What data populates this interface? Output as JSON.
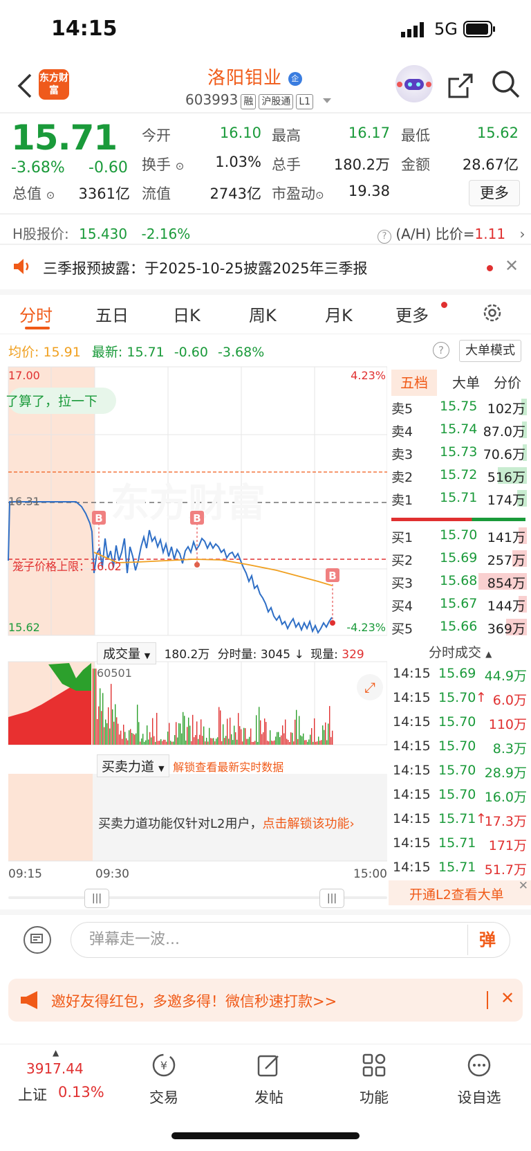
{
  "status": {
    "time": "14:15",
    "network": "5G"
  },
  "header": {
    "app_logo": "东方财富",
    "stock_name": "洛阳钼业",
    "stock_badge": "企",
    "stock_code": "603993",
    "tags": [
      "融",
      "沪股通",
      "L1"
    ]
  },
  "quote": {
    "price": "15.71",
    "change_pct": "-3.68%",
    "change_abs": "-0.60",
    "fields": [
      {
        "label": "今开",
        "value": "16.10",
        "color": "green"
      },
      {
        "label": "最高",
        "value": "16.17",
        "color": "green"
      },
      {
        "label": "最低",
        "value": "15.62",
        "color": "green"
      },
      {
        "label": "换手",
        "value": "1.03%",
        "color": "black"
      },
      {
        "label": "总手",
        "value": "180.2万",
        "color": "black"
      },
      {
        "label": "金额",
        "value": "28.67亿",
        "color": "black"
      },
      {
        "label": "总值",
        "value": "3361亿",
        "color": "black"
      },
      {
        "label": "流值",
        "value": "2743亿",
        "color": "black"
      },
      {
        "label": "市盈动",
        "value": "19.38",
        "color": "black"
      }
    ],
    "more_label": "更多"
  },
  "hshare": {
    "label": "H股报价:",
    "price": "15.430",
    "pct": "-2.16%",
    "ah_label": "(A/H) 比价=",
    "ah_value": "1.11"
  },
  "notice": {
    "text": "三季报预披露：于2025-10-25披露2025年三季报"
  },
  "tabs": [
    "分时",
    "五日",
    "日K",
    "周K",
    "月K",
    "更多"
  ],
  "chart_header": {
    "avg_label": "均价:",
    "avg_value": "15.91",
    "latest_label": "最新:",
    "latest_value": "15.71",
    "latest_change": "-0.60",
    "latest_pct": "-3.68%",
    "big_mode": "大单模式"
  },
  "chart_labels": {
    "top_price": "17.00",
    "top_pct": "4.23%",
    "prev_close": "16.31",
    "bottom_price": "15.62",
    "bottom_pct": "-4.23%",
    "danmu_bubble": "了算了，拉一下",
    "cage_limit": "笼子价格上限：16.02",
    "watermark": "东方财富",
    "buy_marker": "B"
  },
  "volume_bar": {
    "label": "成交量",
    "total": "180.2万",
    "split_label": "分时量:",
    "split_value": "3045",
    "arrow": "↓",
    "now_label": "现量:",
    "now_value": "329",
    "max_vol": "60501"
  },
  "force": {
    "label": "买卖力道",
    "unlock": "解锁查看最新实时数据",
    "notice": "买卖力道功能仅针对L2用户，",
    "notice_link": "点击解锁该功能"
  },
  "time_axis": [
    "09:15",
    "09:30",
    "15:00"
  ],
  "orderbook": {
    "tabs": [
      "五档",
      "大单",
      "分价"
    ],
    "sells": [
      {
        "label": "卖5",
        "price": "15.75",
        "vol": "102万",
        "bar": 0.12
      },
      {
        "label": "卖4",
        "price": "15.74",
        "vol": "87.0万",
        "bar": 0.1
      },
      {
        "label": "卖3",
        "price": "15.73",
        "vol": "70.6万",
        "bar": 0.08
      },
      {
        "label": "卖2",
        "price": "15.72",
        "vol": "516万",
        "bar": 0.6
      },
      {
        "label": "卖1",
        "price": "15.71",
        "vol": "174万",
        "bar": 0.2
      }
    ],
    "buys": [
      {
        "label": "买1",
        "price": "15.70",
        "vol": "141万",
        "bar": 0.17
      },
      {
        "label": "买2",
        "price": "15.69",
        "vol": "257万",
        "bar": 0.3
      },
      {
        "label": "买3",
        "price": "15.68",
        "vol": "854万",
        "bar": 1.0
      },
      {
        "label": "买4",
        "price": "15.67",
        "vol": "144万",
        "bar": 0.17
      },
      {
        "label": "买5",
        "price": "15.66",
        "vol": "369万",
        "bar": 0.43
      }
    ]
  },
  "trades": {
    "title": "分时成交",
    "rows": [
      {
        "time": "14:15",
        "price": "15.69",
        "vol": "44.9万",
        "color": "green",
        "arrow": ""
      },
      {
        "time": "14:15",
        "price": "15.70",
        "vol": "6.0万",
        "color": "red",
        "arrow": "↑"
      },
      {
        "time": "14:15",
        "price": "15.70",
        "vol": "110万",
        "color": "red",
        "arrow": ""
      },
      {
        "time": "14:15",
        "price": "15.70",
        "vol": "8.3万",
        "color": "green",
        "arrow": ""
      },
      {
        "time": "14:15",
        "price": "15.70",
        "vol": "28.9万",
        "color": "green",
        "arrow": ""
      },
      {
        "time": "14:15",
        "price": "15.70",
        "vol": "16.0万",
        "color": "green",
        "arrow": ""
      },
      {
        "time": "14:15",
        "price": "15.71",
        "vol": "17.3万",
        "color": "red",
        "arrow": "↑"
      },
      {
        "time": "14:15",
        "price": "15.71",
        "vol": "171万",
        "color": "red",
        "arrow": ""
      },
      {
        "time": "14:15",
        "price": "15.71",
        "vol": "51.7万",
        "color": "red",
        "arrow": ""
      }
    ],
    "l2_banner": "开通L2查看大单"
  },
  "danmu": {
    "placeholder": "弹幕走一波...",
    "button": "弹"
  },
  "invite": {
    "text": "邀好友得红包，多邀多得！微信秒速打款>>"
  },
  "bottom_nav": {
    "index_value": "3917.44",
    "index_name": "上证",
    "index_pct": "0.13%",
    "items": [
      "交易",
      "发帖",
      "功能",
      "设自选"
    ]
  },
  "colors": {
    "accent": "#f05a18",
    "up": "#e03030",
    "down": "#1a9a3a",
    "line": "#2f6fc6",
    "avg": "#f0a020"
  }
}
